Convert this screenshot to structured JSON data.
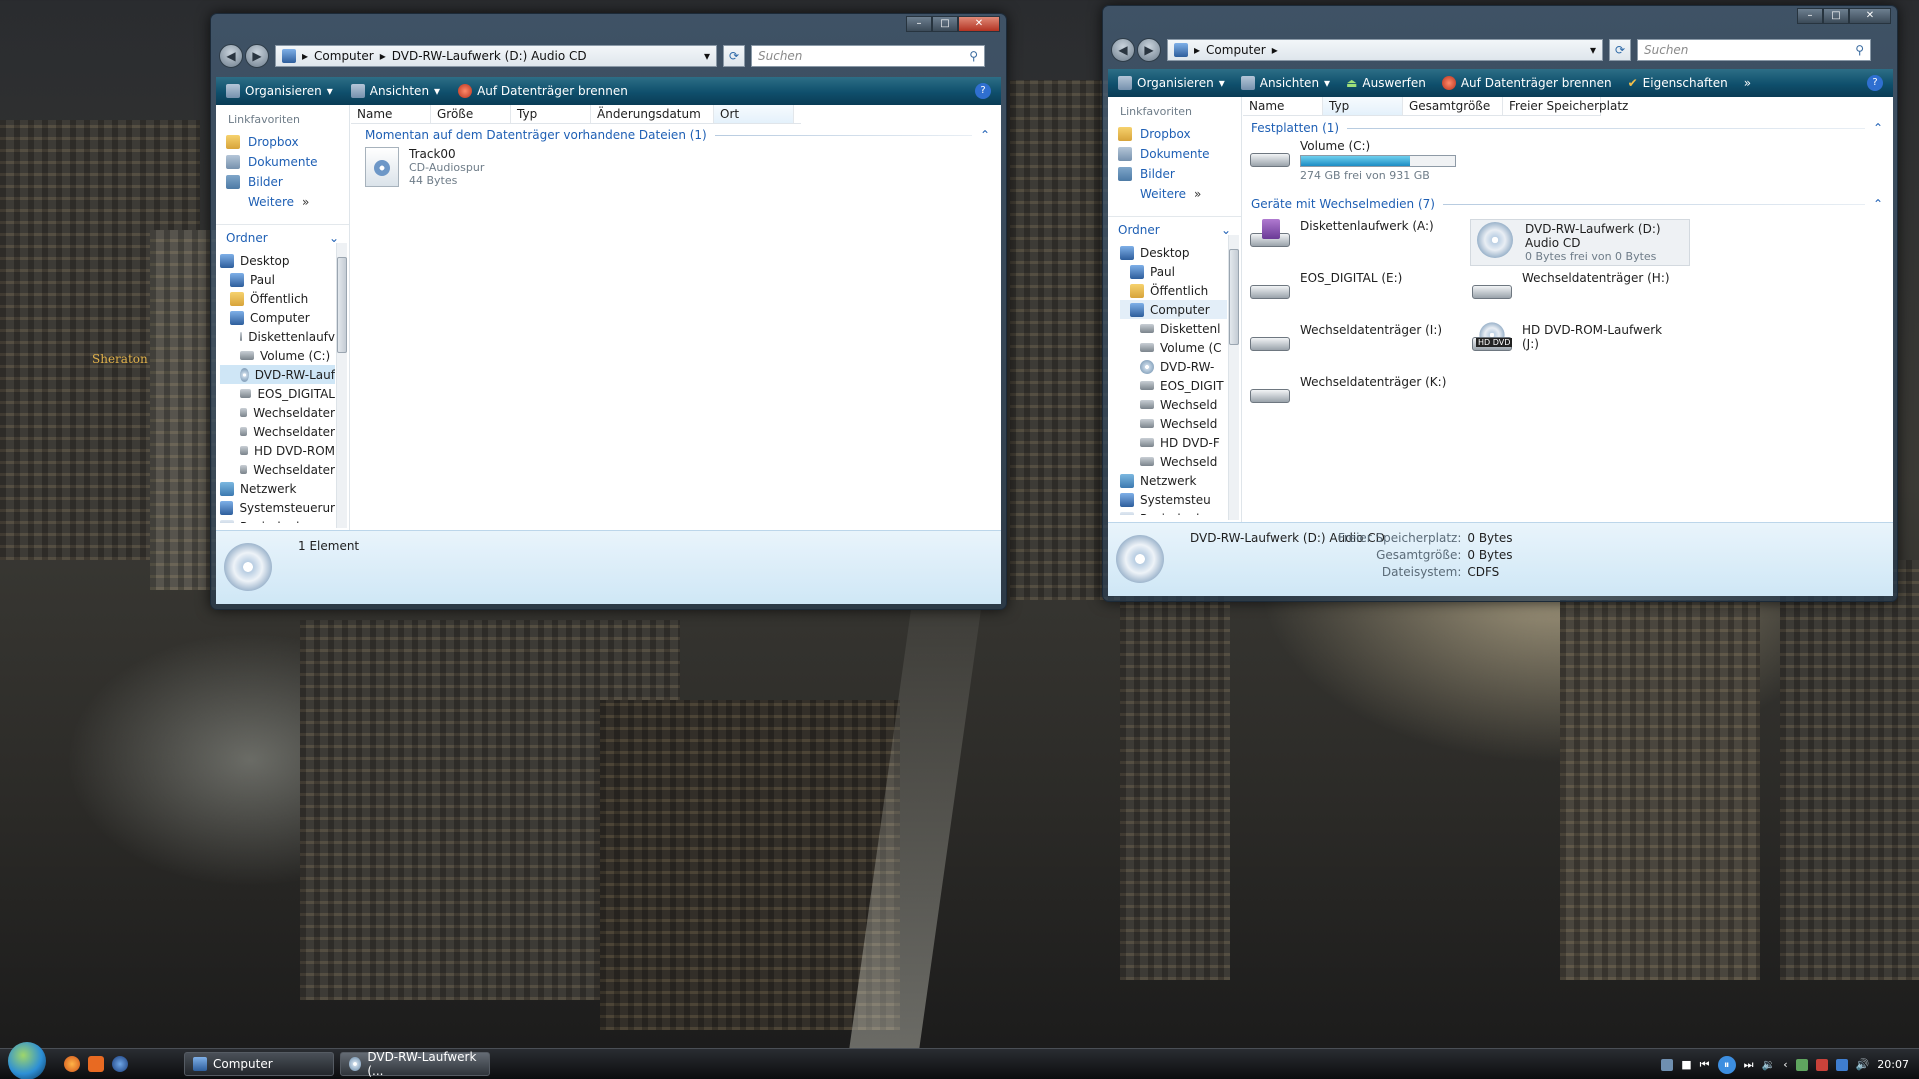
{
  "window1": {
    "breadcrumb": [
      "Computer",
      "DVD-RW-Laufwerk (D:) Audio CD"
    ],
    "search_placeholder": "Suchen",
    "toolbar": {
      "organize": "Organisieren",
      "views": "Ansichten",
      "burn": "Auf Datenträger brennen"
    },
    "favorites_header": "Linkfavoriten",
    "favorites": [
      "Dropbox",
      "Dokumente",
      "Bilder"
    ],
    "more": "Weitere",
    "folders_header": "Ordner",
    "tree": [
      {
        "label": "Desktop",
        "icon": "pc"
      },
      {
        "label": "Paul",
        "icon": "pc"
      },
      {
        "label": "Öffentlich",
        "icon": "folder"
      },
      {
        "label": "Computer",
        "icon": "pc"
      },
      {
        "label": "Diskettenlaufv",
        "icon": "drive"
      },
      {
        "label": "Volume (C:)",
        "icon": "drive"
      },
      {
        "label": "DVD-RW-Lauf",
        "icon": "cd"
      },
      {
        "label": "EOS_DIGITAL",
        "icon": "drive"
      },
      {
        "label": "Wechseldater",
        "icon": "drive"
      },
      {
        "label": "Wechseldater",
        "icon": "drive"
      },
      {
        "label": "HD DVD-ROM",
        "icon": "drive"
      },
      {
        "label": "Wechseldater",
        "icon": "drive"
      },
      {
        "label": "Netzwerk",
        "icon": "net"
      },
      {
        "label": "Systemsteuerur",
        "icon": "pc"
      },
      {
        "label": "Papierkorb",
        "icon": "bin"
      }
    ],
    "columns": [
      "Name",
      "Größe",
      "Typ",
      "Änderungsdatum",
      "Ort"
    ],
    "group_label": "Momentan auf dem Datenträger vorhandene Dateien (1)",
    "file": {
      "name": "Track00",
      "type": "CD-Audiospur",
      "size": "44 Bytes"
    },
    "status": "1 Element"
  },
  "window2": {
    "breadcrumb": [
      "Computer"
    ],
    "search_placeholder": "Suchen",
    "toolbar": {
      "organize": "Organisieren",
      "views": "Ansichten",
      "eject": "Auswerfen",
      "burn": "Auf Datenträger brennen",
      "properties": "Eigenschaften"
    },
    "favorites_header": "Linkfavoriten",
    "favorites": [
      "Dropbox",
      "Dokumente",
      "Bilder"
    ],
    "more": "Weitere",
    "folders_header": "Ordner",
    "tree": [
      {
        "label": "Desktop",
        "icon": "pc"
      },
      {
        "label": "Paul",
        "icon": "pc"
      },
      {
        "label": "Öffentlich",
        "icon": "folder"
      },
      {
        "label": "Computer",
        "icon": "pc"
      },
      {
        "label": "Diskettenl",
        "icon": "drive"
      },
      {
        "label": "Volume (C",
        "icon": "drive"
      },
      {
        "label": "DVD-RW-",
        "icon": "cd"
      },
      {
        "label": "EOS_DIGIT",
        "icon": "drive"
      },
      {
        "label": "Wechseld",
        "icon": "drive"
      },
      {
        "label": "Wechseld",
        "icon": "drive"
      },
      {
        "label": "HD DVD-F",
        "icon": "drive"
      },
      {
        "label": "Wechseld",
        "icon": "drive"
      },
      {
        "label": "Netzwerk",
        "icon": "net"
      },
      {
        "label": "Systemsteu",
        "icon": "pc"
      },
      {
        "label": "Papierkorb",
        "icon": "bin"
      }
    ],
    "columns": [
      "Name",
      "Typ",
      "Gesamtgröße",
      "Freier Speicherplatz"
    ],
    "group_hdd": "Festplatten (1)",
    "hdd": {
      "name": "Volume (C:)",
      "free": "274 GB frei von 931 GB",
      "used_fraction": 0.71
    },
    "group_removable": "Geräte mit Wechselmedien (7)",
    "devices": [
      {
        "name": "Diskettenlaufwerk (A:)",
        "sub": "",
        "icon": "floppy"
      },
      {
        "name": "DVD-RW-Laufwerk (D:) Audio CD",
        "sub": "0 Bytes frei von 0 Bytes",
        "icon": "cd"
      },
      {
        "name": "EOS_DIGITAL (E:)",
        "sub": "",
        "icon": "drive"
      },
      {
        "name": "Wechseldatenträger (H:)",
        "sub": "",
        "icon": "drive"
      },
      {
        "name": "Wechseldatenträger (I:)",
        "sub": "",
        "icon": "drive"
      },
      {
        "name": "HD DVD-ROM-Laufwerk (J:)",
        "sub": "",
        "icon": "hddvd"
      },
      {
        "name": "Wechseldatenträger (K:)",
        "sub": "",
        "icon": "drive"
      }
    ],
    "hd_dvd_badge": "HD DVD",
    "status": {
      "title": "DVD-RW-Laufwerk (D:) Audio CD",
      "free_label": "Freier Speicherplatz:",
      "free_value": "0 Bytes",
      "total_label": "Gesamtgröße:",
      "total_value": "0 Bytes",
      "fs_label": "Dateisystem:",
      "fs_value": "CDFS"
    }
  },
  "taskbar": {
    "buttons": [
      "Computer",
      "DVD-RW-Laufwerk (..."
    ],
    "clock": "20:07"
  },
  "wallpaper": {
    "sign": "Sheraton"
  }
}
